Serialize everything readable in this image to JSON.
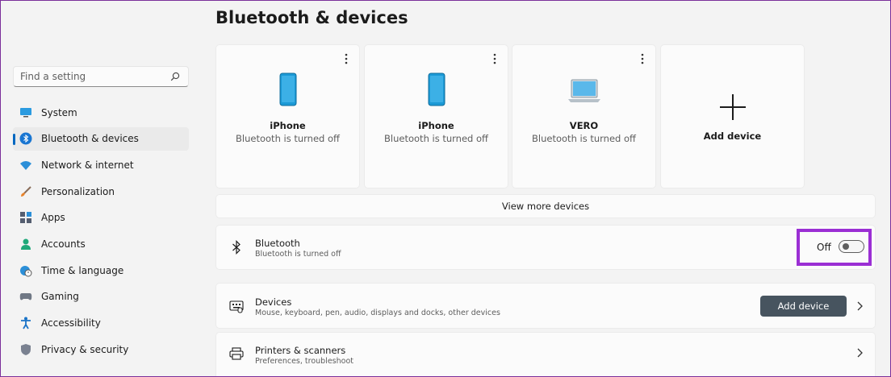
{
  "page": {
    "title": "Bluetooth & devices"
  },
  "search": {
    "placeholder": "Find a setting"
  },
  "sidebar": {
    "items": [
      {
        "label": "System",
        "icon": "monitor-icon"
      },
      {
        "label": "Bluetooth & devices",
        "icon": "bluetooth-icon",
        "active": true
      },
      {
        "label": "Network & internet",
        "icon": "wifi-icon"
      },
      {
        "label": "Personalization",
        "icon": "brush-icon"
      },
      {
        "label": "Apps",
        "icon": "apps-icon"
      },
      {
        "label": "Accounts",
        "icon": "person-icon"
      },
      {
        "label": "Time & language",
        "icon": "globe-clock-icon"
      },
      {
        "label": "Gaming",
        "icon": "controller-icon"
      },
      {
        "label": "Accessibility",
        "icon": "accessibility-icon"
      },
      {
        "label": "Privacy & security",
        "icon": "shield-icon"
      }
    ]
  },
  "devices": [
    {
      "name": "iPhone",
      "status": "Bluetooth is turned off",
      "icon": "phone-icon"
    },
    {
      "name": "iPhone",
      "status": "Bluetooth is turned off",
      "icon": "phone-icon"
    },
    {
      "name": "VERO",
      "status": "Bluetooth is turned off",
      "icon": "laptop-icon"
    }
  ],
  "add_device_tile": {
    "label": "Add device"
  },
  "view_more": {
    "label": "View more devices"
  },
  "bluetooth": {
    "title": "Bluetooth",
    "subtitle": "Bluetooth is turned off",
    "toggle_label": "Off",
    "enabled": false
  },
  "devices_section": {
    "title": "Devices",
    "subtitle": "Mouse, keyboard, pen, audio, displays and docks, other devices",
    "button_label": "Add device"
  },
  "printers_section": {
    "title": "Printers & scanners",
    "subtitle": "Preferences, troubleshoot"
  },
  "colors": {
    "accent": "#0067c0",
    "highlight": "#9b2fd4",
    "button": "#47545f",
    "phone": "#1c9ad6"
  }
}
